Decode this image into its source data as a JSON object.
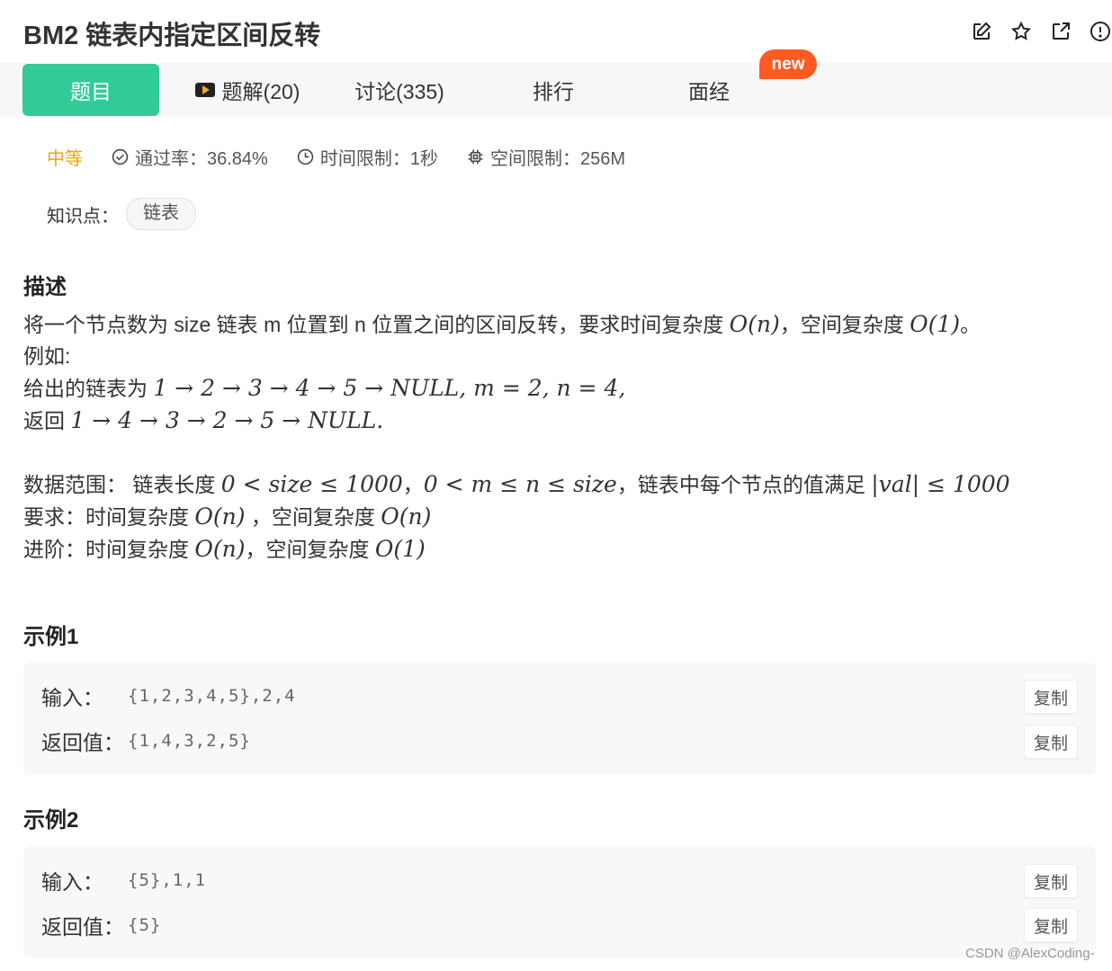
{
  "header": {
    "title": "BM2  链表内指定区间反转",
    "icons": [
      "edit-icon",
      "star-icon",
      "share-icon",
      "report-icon"
    ]
  },
  "tabs": [
    {
      "label": "题目",
      "active": true
    },
    {
      "label": "题解(20)",
      "icon": "video-icon"
    },
    {
      "label": "讨论(335)"
    },
    {
      "label": "排行"
    },
    {
      "label": "面经"
    }
  ],
  "badge": {
    "new": "new"
  },
  "meta": {
    "difficulty": "中等",
    "pass_rate": "通过率：36.84%",
    "time_limit": "时间限制：1秒",
    "space_limit": "空间限制：256M"
  },
  "knowledge": {
    "label": "知识点：",
    "tag": "链表"
  },
  "description": {
    "heading": "描述",
    "line1_text": "将一个节点数为 size 链表 m 位置到 n 位置之间的区间反转，要求时间复杂度 ",
    "line1_mid": "，空间复杂度 ",
    "line1_end": "。",
    "example_intro": "例如:",
    "given_prefix": "给出的链表为 ",
    "given_math": "1 → 2 → 3 → 4 → 5 → NULL, m = 2, n = 4,",
    "return_prefix": "返回 ",
    "return_math": "1 → 4 → 3 → 2 → 5 → NULL.",
    "range_label": "数据范围：  链表长度 ",
    "range_math1": "0 < size ≤ 1000",
    "range_sep": "，",
    "range_math2": "0 < m ≤ n ≤ size",
    "range_mid": "，链表中每个节点的值满足 ",
    "range_math3": "|val| ≤ 1000",
    "req_label": "要求：时间复杂度 ",
    "req_mid": " ，空间复杂度 ",
    "adv_label": "进阶：时间复杂度 ",
    "adv_mid": "，空间复杂度 ",
    "o_n": "O(n)",
    "o_1": "O(1)"
  },
  "examples": [
    {
      "heading": "示例1",
      "input_label": "输入：",
      "input_value": "{1,2,3,4,5},2,4",
      "output_label": "返回值：",
      "output_value": "{1,4,3,2,5}",
      "copy": "复制"
    },
    {
      "heading": "示例2",
      "input_label": "输入：",
      "input_value": "{5},1,1",
      "output_label": "返回值：",
      "output_value": "{5}",
      "copy": "复制"
    }
  ],
  "watermark": "CSDN @AlexCoding-",
  "colors": {
    "accent": "#32ca99",
    "medium": "#f5a400",
    "new_badge": "#ff5a1f"
  }
}
